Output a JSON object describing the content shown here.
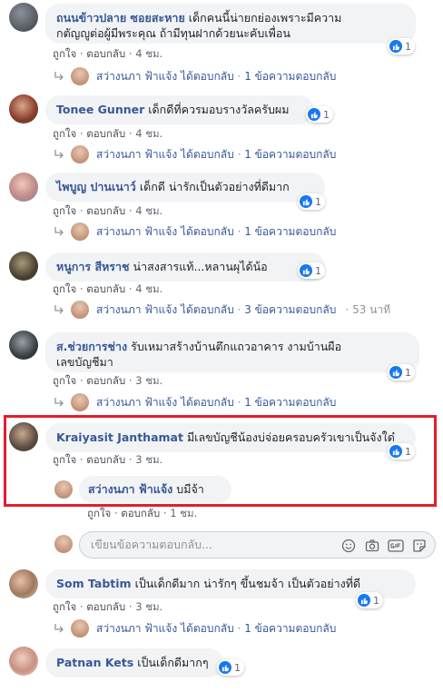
{
  "like_label": "ถูกใจ",
  "reply_label": "ตอบกลับ",
  "replied_text": "ได้ตอบกลับ",
  "sep": "·",
  "comments": [
    {
      "name": "ถนนข้าวปลาย ซอยสะหาย",
      "text_line1": "เด็กคนนี้น่ายกย่องเพราะมีความ",
      "text_line2": "กตัญญูต่อผู้มีพระคุณ ถ้ามีทุนฝากด้วยนะคับเพื่อน",
      "reactions": "1",
      "time": "4 ชม.",
      "reply_name": "สว่างนภา ฟ้าแจ้ง",
      "reply_count": "1 ข้อความตอบกลับ",
      "reply_time": ""
    },
    {
      "name": "Tonee Gunner",
      "text_line1": "เด็กดีที่ควรมอบรางวัลครับผม",
      "text_line2": "",
      "reactions": "1",
      "time": "4 ชม.",
      "reply_name": "สว่างนภา ฟ้าแจ้ง",
      "reply_count": "1 ข้อความตอบกลับ",
      "reply_time": ""
    },
    {
      "name": "ไพบูญ ปานเนาว์",
      "text_line1": "เด็กดี น่ารักเป็นตัวอย่างที่ดีมาก",
      "text_line2": "",
      "reactions": "1",
      "time": "4 ชม.",
      "reply_name": "สว่างนภา ฟ้าแจ้ง",
      "reply_count": "1 ข้อความตอบกลับ",
      "reply_time": ""
    },
    {
      "name": "หนูการ สีหราช",
      "text_line1": "น่าสงสารแท้...หลานผุได้น้อ",
      "text_line2": "",
      "reactions": "1",
      "time": "4 ชม.",
      "reply_name": "สว่างนภา ฟ้าแจ้ง",
      "reply_count": "3 ข้อความตอบกลับ",
      "reply_time": "53 นาที"
    },
    {
      "name": "ส.ช่วยการช่าง",
      "text_line1": "รับเหมาสร้างบ้านตึกแถวอาคาร งามบ้านผือ",
      "text_line2": "เลขบัญชีมา",
      "reactions": "1",
      "time": "3 ชม.",
      "reply_name": "สว่างนภา ฟ้าแจ้ง",
      "reply_count": "1 ข้อความตอบกลับ",
      "reply_time": ""
    },
    {
      "name": "Kraiyasit Janthamat",
      "text_line1": "มีเลขบัญชีน้องบ่จ่อยครอบครัวเขาเป็นจังใด๋",
      "text_line2": "",
      "reactions": "1",
      "time": "3 ชม.",
      "reply_name": "",
      "reply_count": "",
      "reply_time": ""
    },
    {
      "name": "Som Tabtim",
      "text_line1": "เป็นเด็กดีมาก น่ารักๆ ขึ้นชมจ้า เป็นตัวอย่างที่ดี",
      "text_line2": "",
      "reactions": "1",
      "time": "3 ชม.",
      "reply_name": "สว่างนภา ฟ้าแจ้ง",
      "reply_count": "1 ข้อความตอบกลับ",
      "reply_time": ""
    },
    {
      "name": "Patnan Kets",
      "text_line1": "เป็นเด็กดีมากๆ",
      "text_line2": "",
      "reactions": "1",
      "time": "",
      "reply_name": "",
      "reply_count": "",
      "reply_time": ""
    }
  ],
  "nested_reply": {
    "name": "สว่างนภา ฟ้าแจ้ง",
    "text": "บมีจ้า",
    "time": "1 ชม."
  },
  "reply_input": {
    "placeholder": "เขียนข้อความตอบกลับ..."
  },
  "colors": {
    "link": "#385898",
    "like_blue": "#1877f2",
    "highlight": "#e41d2b",
    "bubble": "#f2f3f5"
  }
}
